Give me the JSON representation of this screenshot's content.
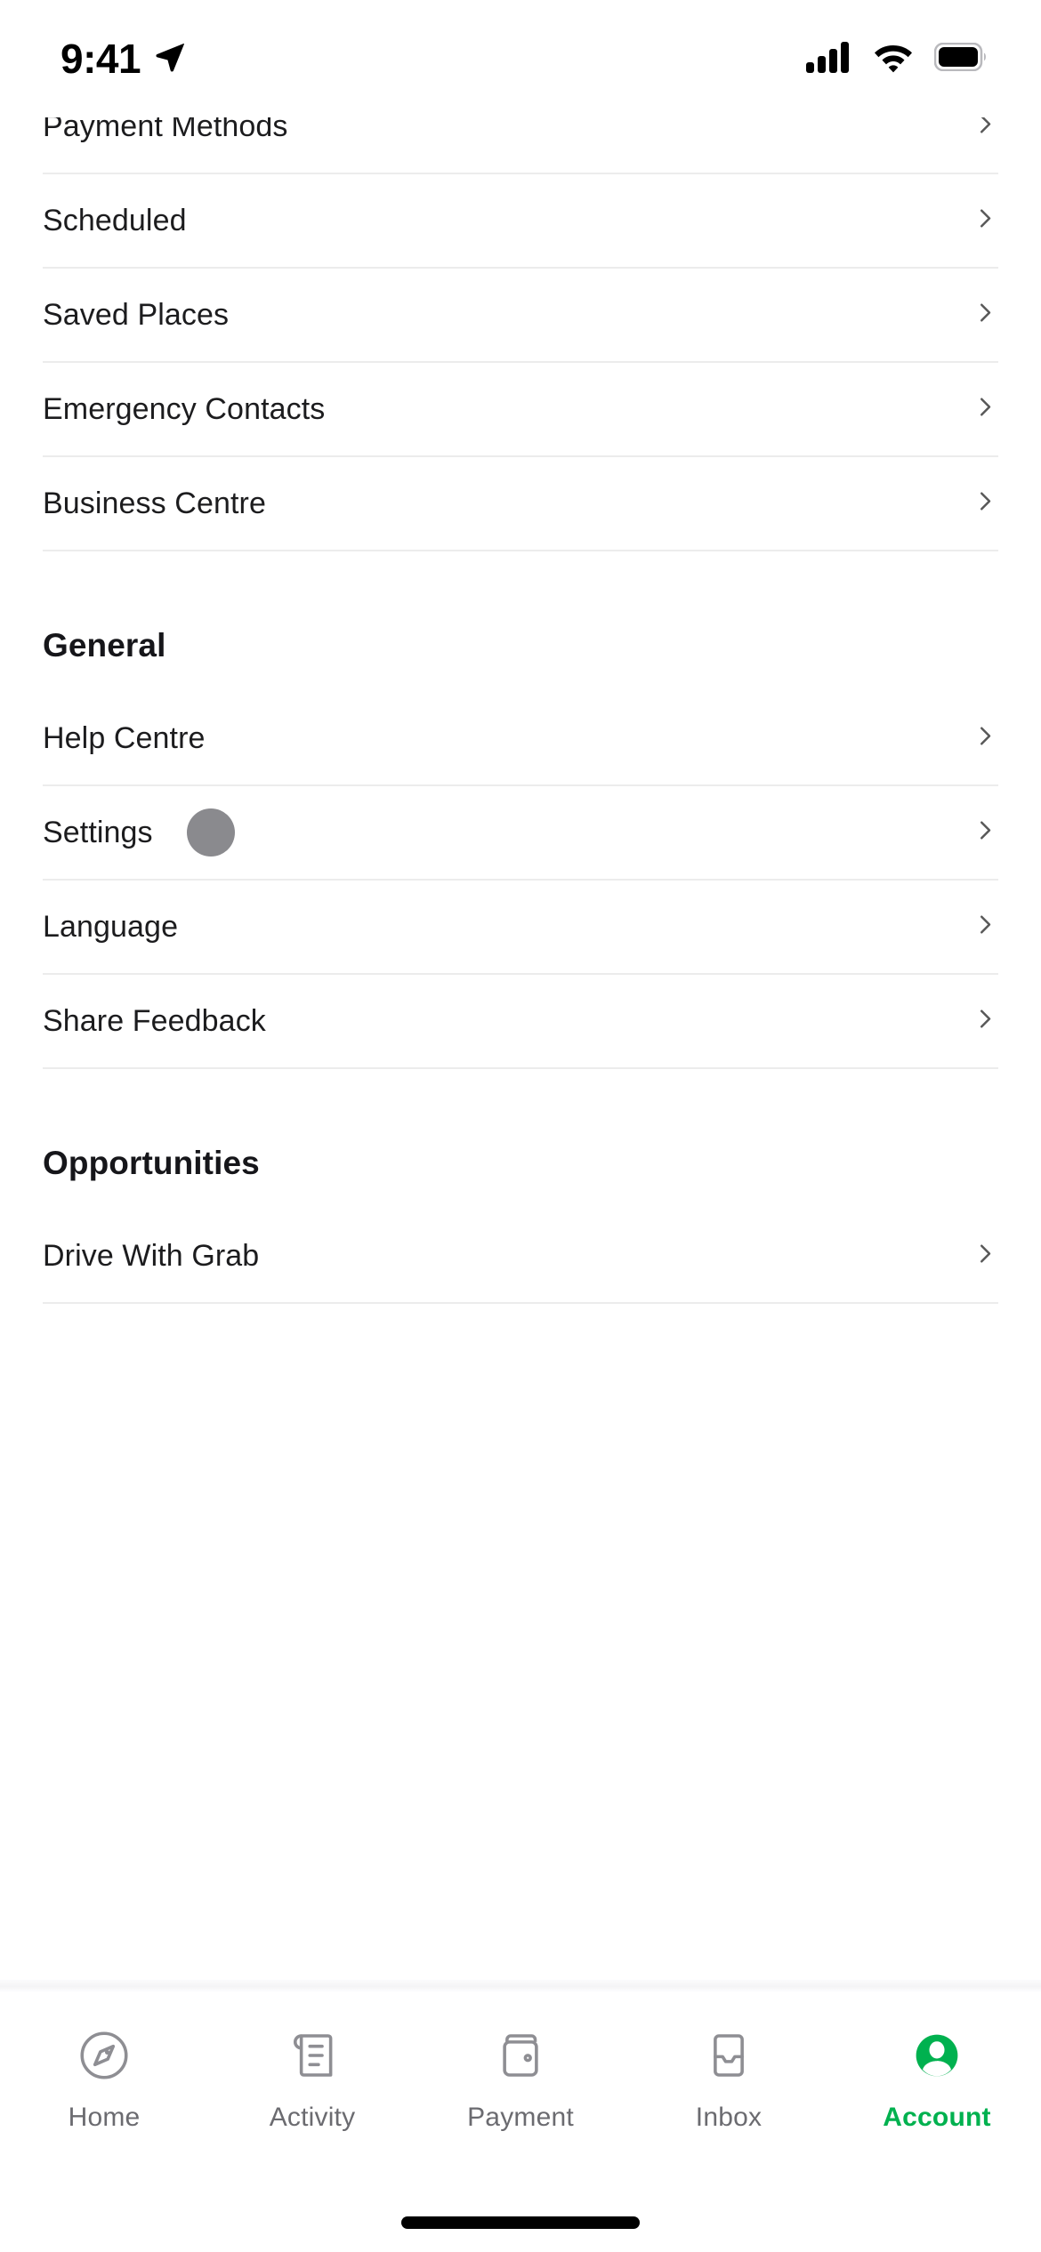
{
  "status_bar": {
    "time": "9:41",
    "icons": [
      "location-arrow-icon",
      "cellular-signal-icon",
      "wifi-icon",
      "battery-icon"
    ]
  },
  "colors": {
    "accent_green": "#00B14F",
    "divider": "#ececec",
    "row_text": "#1c1c1e",
    "section_text": "#16161a",
    "chevron": "#585858",
    "tab_inactive": "#8e8e93",
    "tab_label_inactive": "#6b6b70",
    "badge_gray": "#8a8a8e"
  },
  "list": {
    "clipped_top_row": {
      "label": "Payment Methods",
      "chevron": true
    },
    "account_items": [
      {
        "label": "Scheduled",
        "chevron": true
      },
      {
        "label": "Saved Places",
        "chevron": true
      },
      {
        "label": "Emergency Contacts",
        "chevron": true
      },
      {
        "label": "Business Centre",
        "chevron": true
      }
    ],
    "sections": [
      {
        "title": "General",
        "items": [
          {
            "label": "Help Centre",
            "chevron": true,
            "badge": false
          },
          {
            "label": "Settings",
            "chevron": true,
            "badge": true
          },
          {
            "label": "Language",
            "chevron": true,
            "badge": false
          },
          {
            "label": "Share Feedback",
            "chevron": true,
            "badge": false
          }
        ]
      },
      {
        "title": "Opportunities",
        "items": [
          {
            "label": "Drive With Grab",
            "chevron": true,
            "badge": false
          }
        ]
      }
    ]
  },
  "tabbar": {
    "tabs": [
      {
        "label": "Home",
        "icon": "compass-icon",
        "active": false
      },
      {
        "label": "Activity",
        "icon": "receipt-icon",
        "active": false
      },
      {
        "label": "Payment",
        "icon": "wallet-icon",
        "active": false
      },
      {
        "label": "Inbox",
        "icon": "inbox-tray-icon",
        "active": false
      },
      {
        "label": "Account",
        "icon": "account-person-icon",
        "active": true
      }
    ]
  }
}
